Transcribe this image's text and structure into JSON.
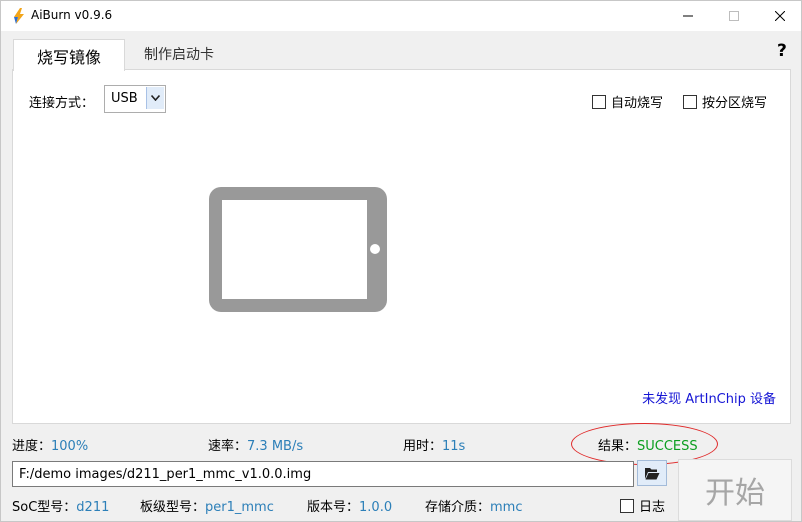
{
  "window": {
    "title": "AiBurn v0.9.6"
  },
  "tabs": [
    {
      "label": "烧写镜像",
      "active": true
    },
    {
      "label": "制作启动卡",
      "active": false
    }
  ],
  "help": "?",
  "connection": {
    "label": "连接方式：",
    "value": "USB"
  },
  "options": {
    "auto_burn": "自动烧写",
    "partition_burn": "按分区烧写"
  },
  "device_status": "未发现 ArtInChip 设备",
  "stats": {
    "progress_label": "进度：",
    "progress_value": "100%",
    "speed_label": "速率：",
    "speed_value": "7.3 MB/s",
    "time_label": "用时：",
    "time_value": "11s",
    "result_label": "结果：",
    "result_value": "SUCCESS"
  },
  "file": {
    "path": "F:/demo images/d211_per1_mmc_v1.0.0.img"
  },
  "start_button": "开始",
  "info": {
    "soc_label": "SoC型号：",
    "soc_value": "d211",
    "board_label": "板级型号：",
    "board_value": "per1_mmc",
    "version_label": "版本号：",
    "version_value": "1.0.0",
    "storage_label": "存储介质：",
    "storage_value": "mmc"
  },
  "log_label": "日志",
  "colors": {
    "result_ok": "#0b9e1f",
    "value_blue": "#2c7fb8",
    "link_blue": "#1515d5",
    "highlight_red": "#e02b2b"
  }
}
